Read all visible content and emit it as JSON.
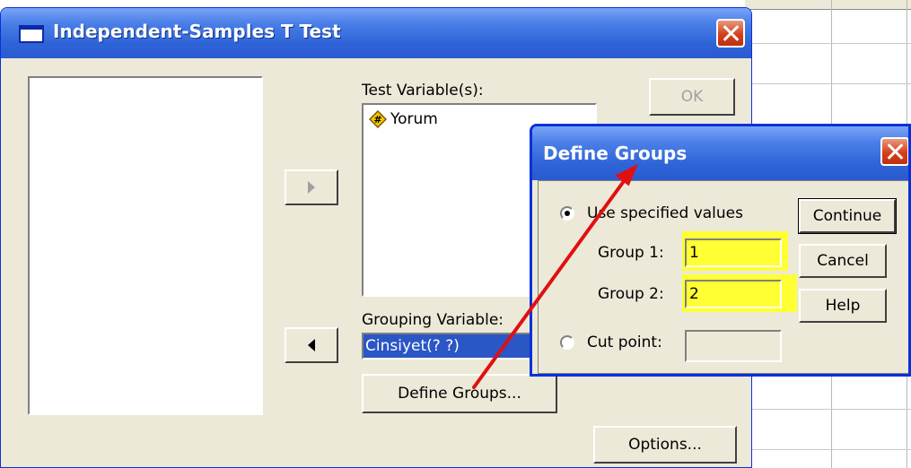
{
  "main_dialog": {
    "title": "Independent-Samples T Test",
    "test_variables_label": "Test Variable(s):",
    "test_variables": [
      {
        "name": "Yorum",
        "icon": "scale-variable-icon"
      }
    ],
    "grouping_variable_label": "Grouping Variable:",
    "grouping_variable_value": "Cinsiyet(? ?)",
    "buttons": {
      "ok": "OK",
      "define_groups": "Define Groups...",
      "options": "Options..."
    }
  },
  "define_groups_dialog": {
    "title": "Define Groups",
    "use_specified_values_label": "Use specified values",
    "group1_label": "Group 1:",
    "group1_value": "1",
    "group2_label": "Group 2:",
    "group2_value": "2",
    "cut_point_label": "Cut point:",
    "cut_point_value": "",
    "selected_option": "Use specified values",
    "buttons": {
      "continue": "Continue",
      "cancel": "Cancel",
      "help": "Help"
    }
  },
  "colors": {
    "title_bar": "#2f64d8",
    "dialog_face": "#ece9d8",
    "highlight": "#ffff33",
    "annotation_arrow": "#e01010",
    "selection": "#2a56c6"
  }
}
